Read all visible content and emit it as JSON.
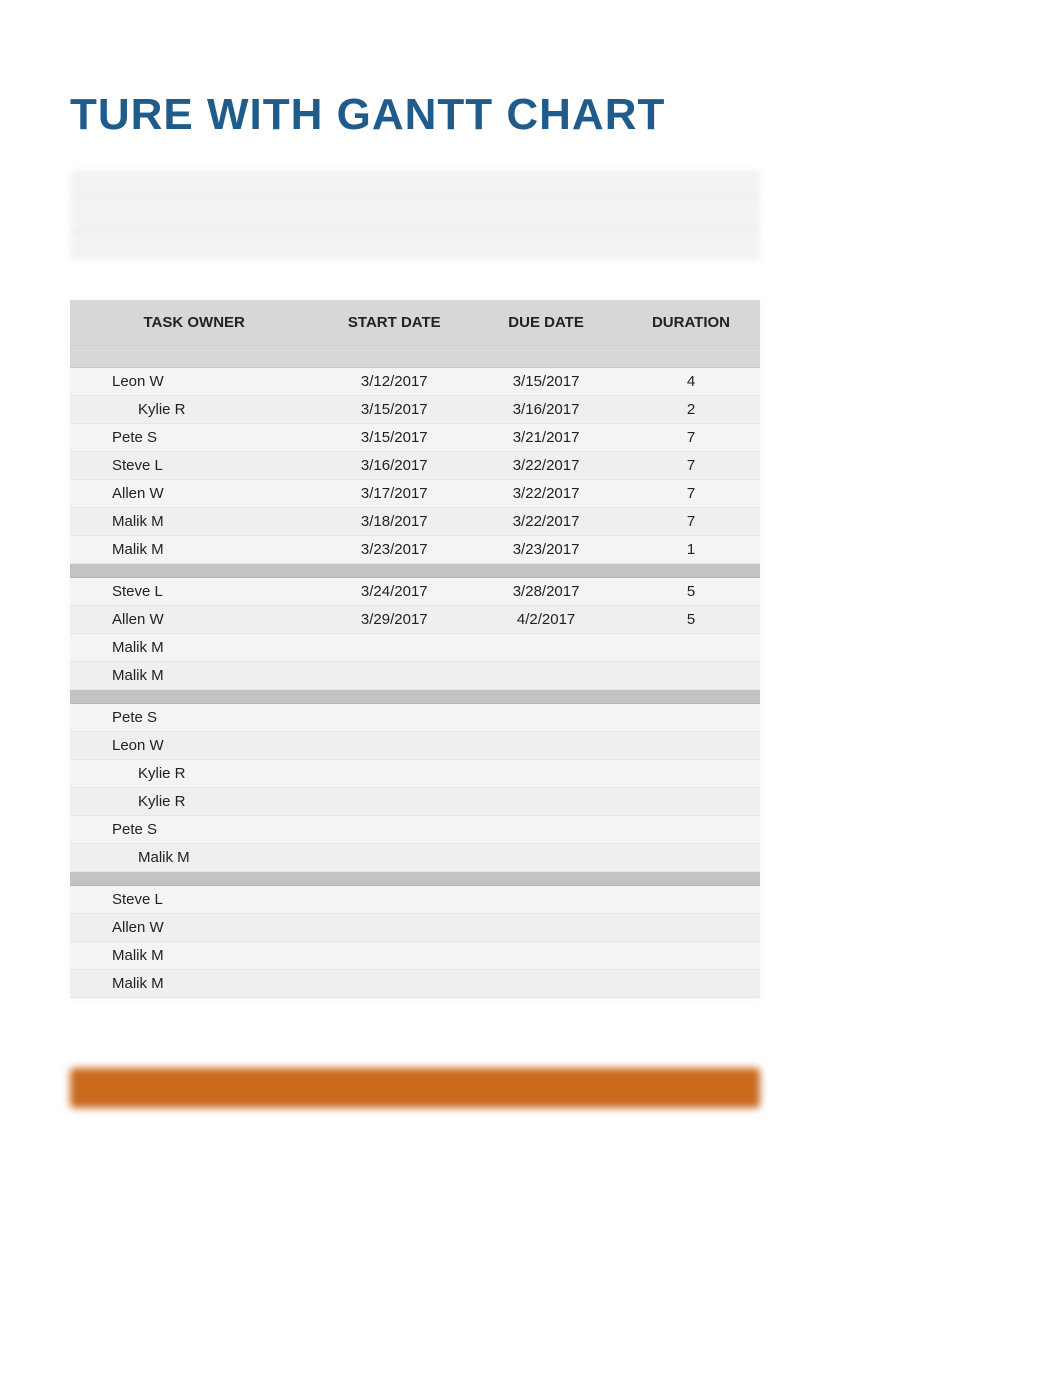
{
  "title": "TURE WITH GANTT CHART",
  "columns": {
    "owner": "TASK OWNER",
    "start": "START DATE",
    "due": "DUE DATE",
    "duration": "DURATION"
  },
  "groups": [
    {
      "rows": [
        {
          "owner": "Leon W",
          "indent": false,
          "start": "3/12/2017",
          "due": "3/15/2017",
          "duration": "4"
        },
        {
          "owner": "Kylie R",
          "indent": true,
          "start": "3/15/2017",
          "due": "3/16/2017",
          "duration": "2"
        },
        {
          "owner": "Pete S",
          "indent": false,
          "start": "3/15/2017",
          "due": "3/21/2017",
          "duration": "7"
        },
        {
          "owner": "Steve L",
          "indent": false,
          "start": "3/16/2017",
          "due": "3/22/2017",
          "duration": "7"
        },
        {
          "owner": "Allen W",
          "indent": false,
          "start": "3/17/2017",
          "due": "3/22/2017",
          "duration": "7"
        },
        {
          "owner": "Malik M",
          "indent": false,
          "start": "3/18/2017",
          "due": "3/22/2017",
          "duration": "7"
        },
        {
          "owner": "Malik M",
          "indent": false,
          "start": "3/23/2017",
          "due": "3/23/2017",
          "duration": "1"
        }
      ]
    },
    {
      "rows": [
        {
          "owner": "Steve L",
          "indent": false,
          "start": "3/24/2017",
          "due": "3/28/2017",
          "duration": "5"
        },
        {
          "owner": "Allen W",
          "indent": false,
          "start": "3/29/2017",
          "due": "4/2/2017",
          "duration": "5"
        },
        {
          "owner": "Malik M",
          "indent": false,
          "start": "",
          "due": "",
          "duration": ""
        },
        {
          "owner": "Malik M",
          "indent": false,
          "start": "",
          "due": "",
          "duration": ""
        }
      ]
    },
    {
      "rows": [
        {
          "owner": "Pete S",
          "indent": false,
          "start": "",
          "due": "",
          "duration": ""
        },
        {
          "owner": "Leon W",
          "indent": false,
          "start": "",
          "due": "",
          "duration": ""
        },
        {
          "owner": "Kylie R",
          "indent": true,
          "start": "",
          "due": "",
          "duration": ""
        },
        {
          "owner": "Kylie R",
          "indent": true,
          "start": "",
          "due": "",
          "duration": ""
        },
        {
          "owner": "Pete S",
          "indent": false,
          "start": "",
          "due": "",
          "duration": ""
        },
        {
          "owner": "Malik M",
          "indent": true,
          "start": "",
          "due": "",
          "duration": ""
        }
      ]
    },
    {
      "rows": [
        {
          "owner": "Steve L",
          "indent": false,
          "start": "",
          "due": "",
          "duration": ""
        },
        {
          "owner": "Allen W",
          "indent": false,
          "start": "",
          "due": "",
          "duration": ""
        },
        {
          "owner": "Malik M",
          "indent": false,
          "start": "",
          "due": "",
          "duration": ""
        },
        {
          "owner": "Malik M",
          "indent": false,
          "start": "",
          "due": "",
          "duration": ""
        }
      ]
    }
  ],
  "chart_data": {
    "type": "table",
    "title": "TURE WITH GANTT CHART",
    "columns": [
      "TASK OWNER",
      "START DATE",
      "DUE DATE",
      "DURATION"
    ],
    "rows": [
      [
        "Leon W",
        "3/12/2017",
        "3/15/2017",
        4
      ],
      [
        "Kylie R",
        "3/15/2017",
        "3/16/2017",
        2
      ],
      [
        "Pete S",
        "3/15/2017",
        "3/21/2017",
        7
      ],
      [
        "Steve L",
        "3/16/2017",
        "3/22/2017",
        7
      ],
      [
        "Allen W",
        "3/17/2017",
        "3/22/2017",
        7
      ],
      [
        "Malik M",
        "3/18/2017",
        "3/22/2017",
        7
      ],
      [
        "Malik M",
        "3/23/2017",
        "3/23/2017",
        1
      ],
      [
        "Steve L",
        "3/24/2017",
        "3/28/2017",
        5
      ],
      [
        "Allen W",
        "3/29/2017",
        "4/2/2017",
        5
      ],
      [
        "Malik M",
        "",
        "",
        null
      ],
      [
        "Malik M",
        "",
        "",
        null
      ],
      [
        "Pete S",
        "",
        "",
        null
      ],
      [
        "Leon W",
        "",
        "",
        null
      ],
      [
        "Kylie R",
        "",
        "",
        null
      ],
      [
        "Kylie R",
        "",
        "",
        null
      ],
      [
        "Pete S",
        "",
        "",
        null
      ],
      [
        "Malik M",
        "",
        "",
        null
      ],
      [
        "Steve L",
        "",
        "",
        null
      ],
      [
        "Allen W",
        "",
        "",
        null
      ],
      [
        "Malik M",
        "",
        "",
        null
      ],
      [
        "Malik M",
        "",
        "",
        null
      ]
    ]
  }
}
